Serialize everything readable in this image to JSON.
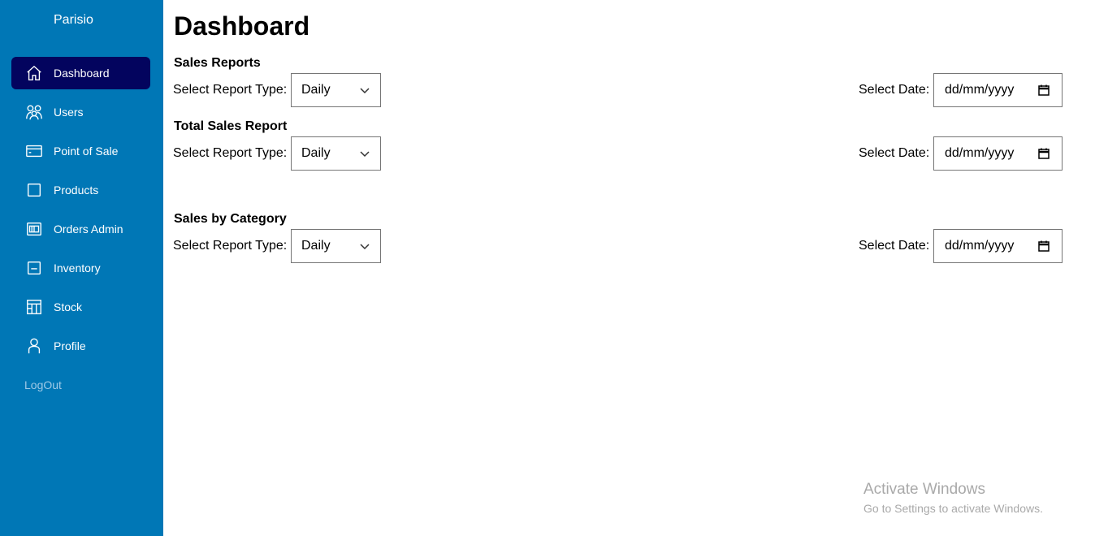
{
  "sidebar": {
    "brand": "Parisio",
    "items": [
      {
        "label": "Dashboard",
        "icon": "home-icon",
        "active": true
      },
      {
        "label": "Users",
        "icon": "users-icon"
      },
      {
        "label": "Point of Sale",
        "icon": "card-icon"
      },
      {
        "label": "Products",
        "icon": "square-icon"
      },
      {
        "label": "Orders Admin",
        "icon": "orders-icon"
      },
      {
        "label": "Inventory",
        "icon": "inventory-icon"
      },
      {
        "label": "Stock",
        "icon": "stock-icon"
      },
      {
        "label": "Profile",
        "icon": "profile-icon"
      }
    ],
    "logout": "LogOut"
  },
  "main": {
    "title": "Dashboard",
    "sections": [
      {
        "title": "Sales Reports",
        "report_label": "Select Report Type:",
        "report_value": "Daily",
        "date_label": "Select Date:",
        "date_placeholder": "dd/mm/yyyy"
      },
      {
        "title": "Total Sales Report",
        "report_label": "Select Report Type:",
        "report_value": "Daily",
        "date_label": "Select Date:",
        "date_placeholder": "dd/mm/yyyy"
      },
      {
        "title": "Sales by Category",
        "report_label": "Select Report Type:",
        "report_value": "Daily",
        "date_label": "Select Date:",
        "date_placeholder": "dd/mm/yyyy"
      }
    ]
  },
  "watermark": {
    "title": "Activate Windows",
    "subtitle": "Go to Settings to activate Windows."
  },
  "colors": {
    "sidebar_bg": "#0077b6",
    "active_bg": "#03045e",
    "logout": "#9ec9e6"
  }
}
